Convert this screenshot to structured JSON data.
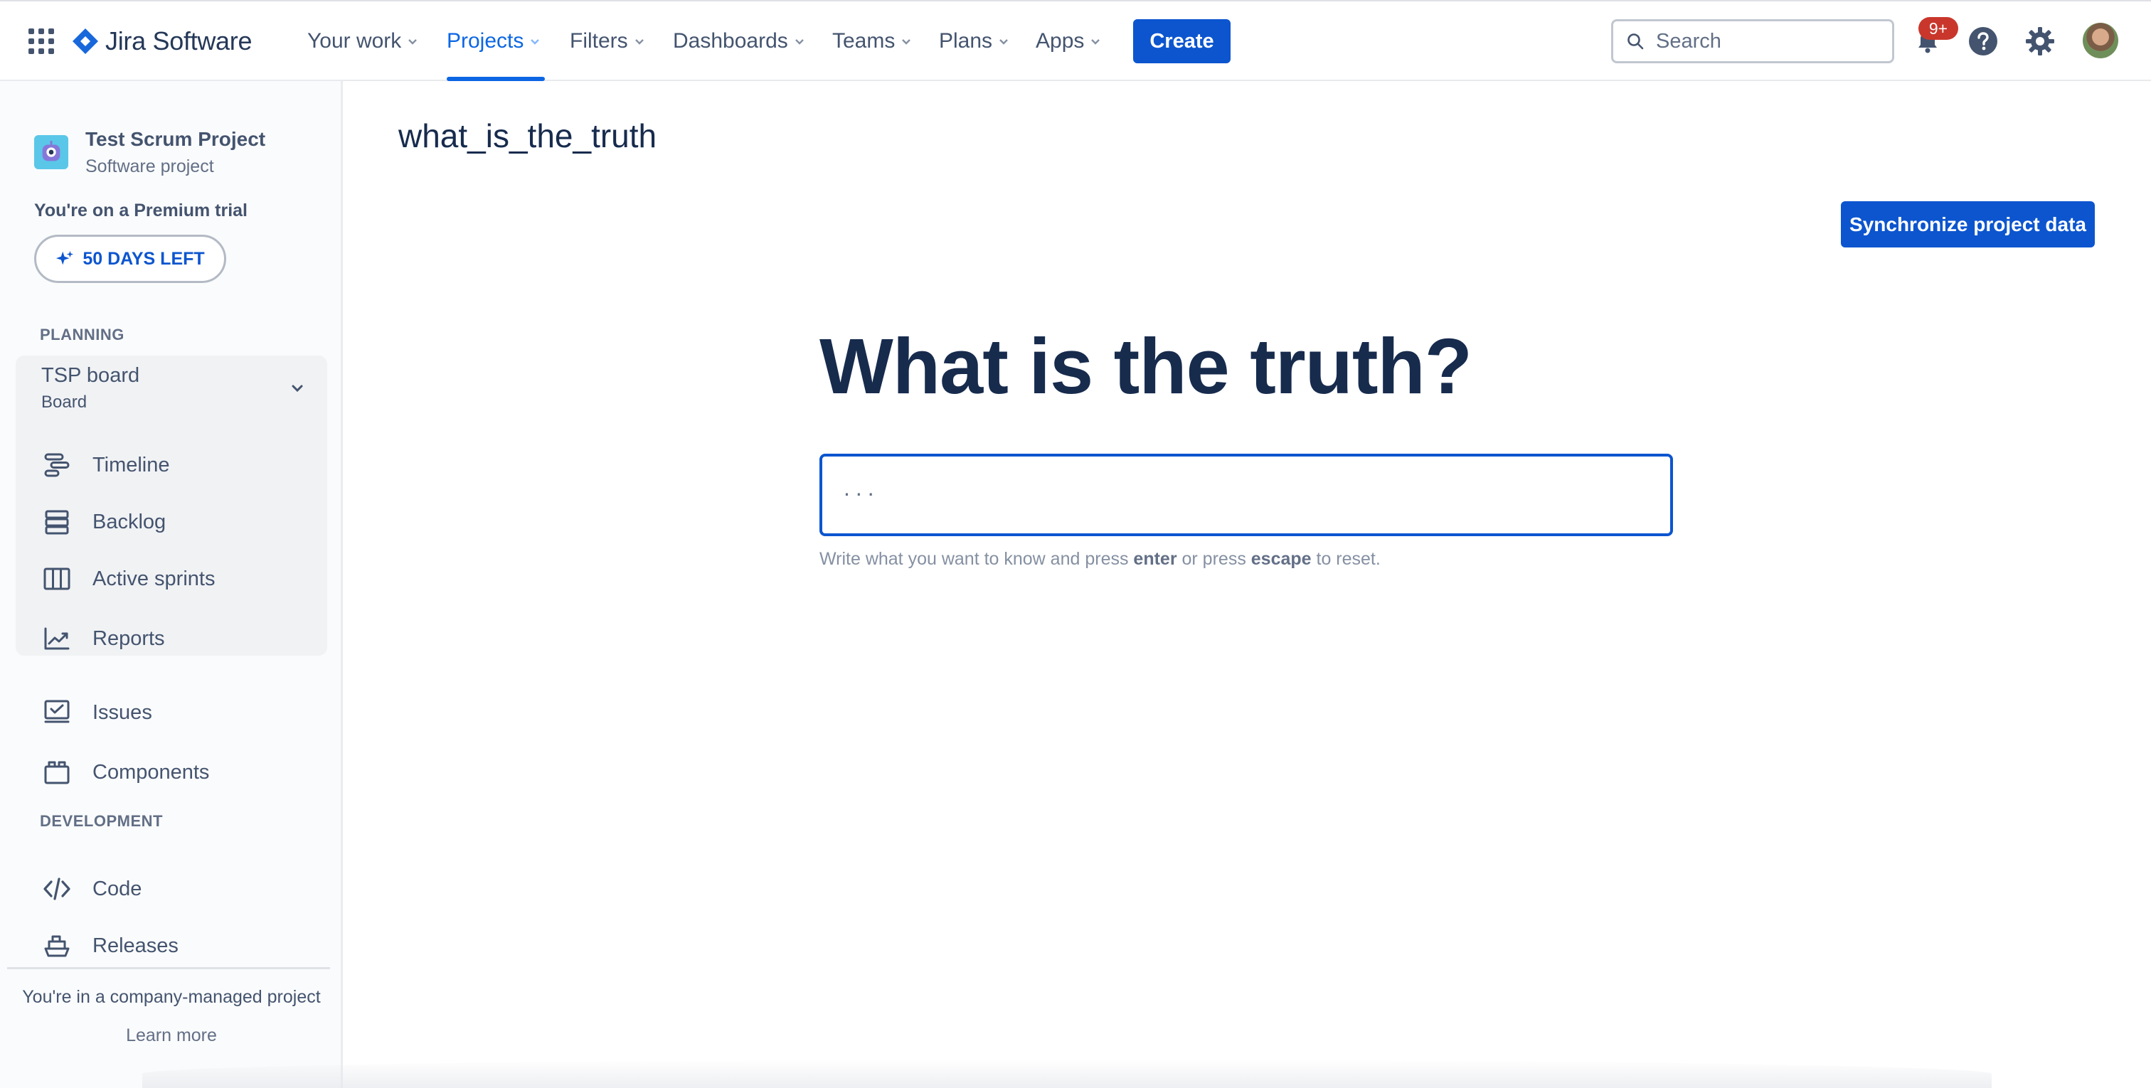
{
  "app": {
    "name": "Jira Software"
  },
  "topnav": {
    "items": [
      {
        "label": "Your work"
      },
      {
        "label": "Projects"
      },
      {
        "label": "Filters"
      },
      {
        "label": "Dashboards"
      },
      {
        "label": "Teams"
      },
      {
        "label": "Plans"
      },
      {
        "label": "Apps"
      }
    ],
    "active_item": "Projects",
    "create_label": "Create",
    "search_placeholder": "Search",
    "notifications_badge": "9+"
  },
  "sidebar": {
    "project_name": "Test Scrum Project",
    "project_type": "Software project",
    "trial_text": "You're on a Premium trial",
    "trial_button": "50 DAYS LEFT",
    "planning_label": "PLANNING",
    "board_name": "TSP board",
    "board_sub": "Board",
    "planning_items": [
      {
        "label": "Timeline",
        "icon": "timeline-icon"
      },
      {
        "label": "Backlog",
        "icon": "backlog-icon"
      },
      {
        "label": "Active sprints",
        "icon": "active-sprints-icon"
      },
      {
        "label": "Reports",
        "icon": "reports-icon"
      }
    ],
    "other_items": [
      {
        "label": "Issues",
        "icon": "issues-icon"
      },
      {
        "label": "Components",
        "icon": "components-icon"
      }
    ],
    "development_label": "DEVELOPMENT",
    "development_items": [
      {
        "label": "Code",
        "icon": "code-icon"
      },
      {
        "label": "Releases",
        "icon": "releases-icon"
      }
    ],
    "company_text": "You're in a company-managed project",
    "learn_more": "Learn more"
  },
  "main": {
    "page_title": "what_is_the_truth",
    "sync_button": "Synchronize project data",
    "heading": "What is the truth?",
    "input_placeholder": "...",
    "hint_before": "Write what you want to know and press ",
    "hint_key1": "enter",
    "hint_middle": " or press ",
    "hint_key2": "escape",
    "hint_after": " to reset."
  },
  "colors": {
    "accent": "#0c66e4",
    "button_primary": "#0c55cf",
    "badge": "#c9372c",
    "text_primary": "#172b4d",
    "text_subtle": "#44546f"
  }
}
